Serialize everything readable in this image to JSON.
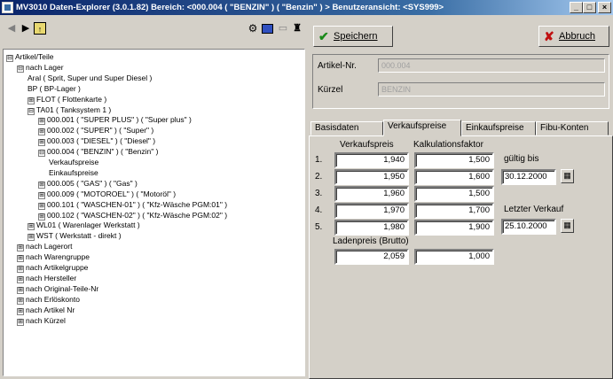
{
  "window": {
    "title": "MV3010 Daten-Explorer (3.0.1.82)  Bereich: <000.004 ( \"BENZIN\" ) ( \"Benzin\" ) >   Benutzeransicht: <SYS999>",
    "btn_min": "_",
    "btn_max": "□",
    "btn_close": "×"
  },
  "nav": {
    "back_icon": "arrow-left-icon",
    "forward_icon": "arrow-right-icon",
    "folder_icon": "folder-icon",
    "tools_icons": [
      "gear-icon",
      "grid-icon",
      "folder-open-icon",
      "person-icon"
    ]
  },
  "tree": [
    {
      "label": "Artikel/Teile",
      "expander": "⊟",
      "level": 0
    },
    {
      "label": "nach Lager",
      "expander": "⊟",
      "level": 1
    },
    {
      "label": "Aral ( Sprit, Super und Super Diesel )",
      "expander": "",
      "level": 2
    },
    {
      "label": "BP ( BP-Lager )",
      "expander": "",
      "level": 2
    },
    {
      "label": "FLOT ( Flottenkarte )",
      "expander": "⊞",
      "level": 2
    },
    {
      "label": "TA01 ( Tanksystem 1 )",
      "expander": "⊟",
      "level": 2
    },
    {
      "label": "000.001 ( \"SUPER PLUS\" ) ( \"Super plus\" )",
      "expander": "⊞",
      "level": 3
    },
    {
      "label": "000.002 ( \"SUPER\" ) ( \"Super\" )",
      "expander": "⊞",
      "level": 3
    },
    {
      "label": "000.003 ( \"DIESEL\" ) ( \"Diesel\" )",
      "expander": "⊞",
      "level": 3
    },
    {
      "label": "000.004 ( \"BENZIN\" ) ( \"Benzin\" )",
      "expander": "⊟",
      "level": 3
    },
    {
      "label": "Verkaufspreise",
      "expander": "",
      "level": 4
    },
    {
      "label": "Einkaufspreise",
      "expander": "",
      "level": 4
    },
    {
      "label": "000.005 ( \"GAS\" ) ( \"Gas\" )",
      "expander": "⊞",
      "level": 3
    },
    {
      "label": "000.009 ( \"MOTOROEL\" ) ( \"Motoröl\" )",
      "expander": "⊞",
      "level": 3
    },
    {
      "label": "000.101 ( \"WASCHEN-01\" ) ( \"Kfz-Wäsche PGM:01\" )",
      "expander": "⊞",
      "level": 3
    },
    {
      "label": "000.102 ( \"WASCHEN-02\" ) ( \"Kfz-Wäsche PGM:02\" )",
      "expander": "⊞",
      "level": 3
    },
    {
      "label": "WL01 ( Warenlager Werkstatt )",
      "expander": "⊞",
      "level": 2
    },
    {
      "label": "WST ( Werkstatt - direkt )",
      "expander": "⊞",
      "level": 2
    },
    {
      "label": "nach Lagerort",
      "expander": "⊞",
      "level": 1
    },
    {
      "label": "nach Warengruppe",
      "expander": "⊞",
      "level": 1
    },
    {
      "label": "nach Artikelgruppe",
      "expander": "⊞",
      "level": 1
    },
    {
      "label": "nach Hersteller",
      "expander": "⊞",
      "level": 1
    },
    {
      "label": "nach Original-Teile-Nr",
      "expander": "⊞",
      "level": 1
    },
    {
      "label": "nach Erlöskonto",
      "expander": "⊞",
      "level": 1
    },
    {
      "label": "nach Artikel Nr",
      "expander": "⊞",
      "level": 1
    },
    {
      "label": "nach Kürzel",
      "expander": "⊞",
      "level": 1
    }
  ],
  "toolbar": {
    "save_label": "Speichern",
    "cancel_label": "Abbruch"
  },
  "header": {
    "artikel_label": "Artikel-Nr.",
    "artikel_value": "000.004",
    "kuerzel_label": "Kürzel",
    "kuerzel_value": "BENZIN"
  },
  "tabs": [
    "Basisdaten",
    "Verkaufspreise",
    "Einkaufspreise",
    "Fibu-Konten"
  ],
  "prices": {
    "col_vk": "Verkaufspreis",
    "col_kf": "Kalkulationsfaktor",
    "rows": [
      {
        "num": "1.",
        "vk": "1,940",
        "kf": "1,500"
      },
      {
        "num": "2.",
        "vk": "1,950",
        "kf": "1,600"
      },
      {
        "num": "3.",
        "vk": "1,960",
        "kf": "1,500"
      },
      {
        "num": "4.",
        "vk": "1,970",
        "kf": "1,700"
      },
      {
        "num": "5.",
        "vk": "1,980",
        "kf": "1,900"
      }
    ],
    "gueltig_label": "gültig bis",
    "gueltig_value": "30.12.2000",
    "letzter_label": "Letzter Verkauf",
    "letzter_value": "25.10.2000",
    "laden_label": "Ladenpreis (Brutto)",
    "laden_value": "2,059",
    "laden_factor": "1,000"
  }
}
